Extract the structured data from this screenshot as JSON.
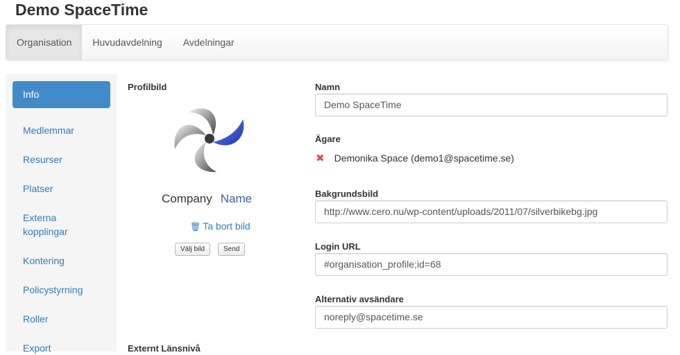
{
  "app": {
    "title": "Demo SpaceTime"
  },
  "nav": {
    "tabs": [
      {
        "label": "Organisation",
        "active": true
      },
      {
        "label": "Huvudavdelning",
        "active": false
      },
      {
        "label": "Avdelningar",
        "active": false
      }
    ]
  },
  "sidebar": {
    "items": [
      {
        "label": "Info",
        "active": true
      },
      {
        "label": "Medlemmar"
      },
      {
        "label": "Resurser"
      },
      {
        "label": "Platser"
      },
      {
        "label": "Externa kopplingar"
      },
      {
        "label": "Kontering"
      },
      {
        "label": "Policystyrning"
      },
      {
        "label": "Roller"
      },
      {
        "label": "Export"
      }
    ]
  },
  "profile": {
    "label": "Profilbild",
    "logo_company": "Company",
    "logo_name": "Name",
    "remove_label": "Ta bort bild",
    "choose_button": "Välj bild",
    "send_button": "Send",
    "below_label": "Externt Länsnivå"
  },
  "form": {
    "name_label": "Namn",
    "name_value": "Demo SpaceTime",
    "owner_label": "Ägare",
    "owner_value": "Demonika Space (demo1@spacetime.se)",
    "background_label": "Bakgrundsbild",
    "background_value": "http://www.cero.nu/wp-content/uploads/2011/07/silverbikebg.jpg",
    "login_label": "Login URL",
    "login_value": "#organisation_profile;id=68",
    "sender_label": "Alternativ avsändare",
    "sender_value": "noreply@spacetime.se"
  },
  "colors": {
    "accent": "#428bca",
    "link": "#337ab7",
    "danger": "#d9534f",
    "logo_name": "#3b5ea8"
  }
}
